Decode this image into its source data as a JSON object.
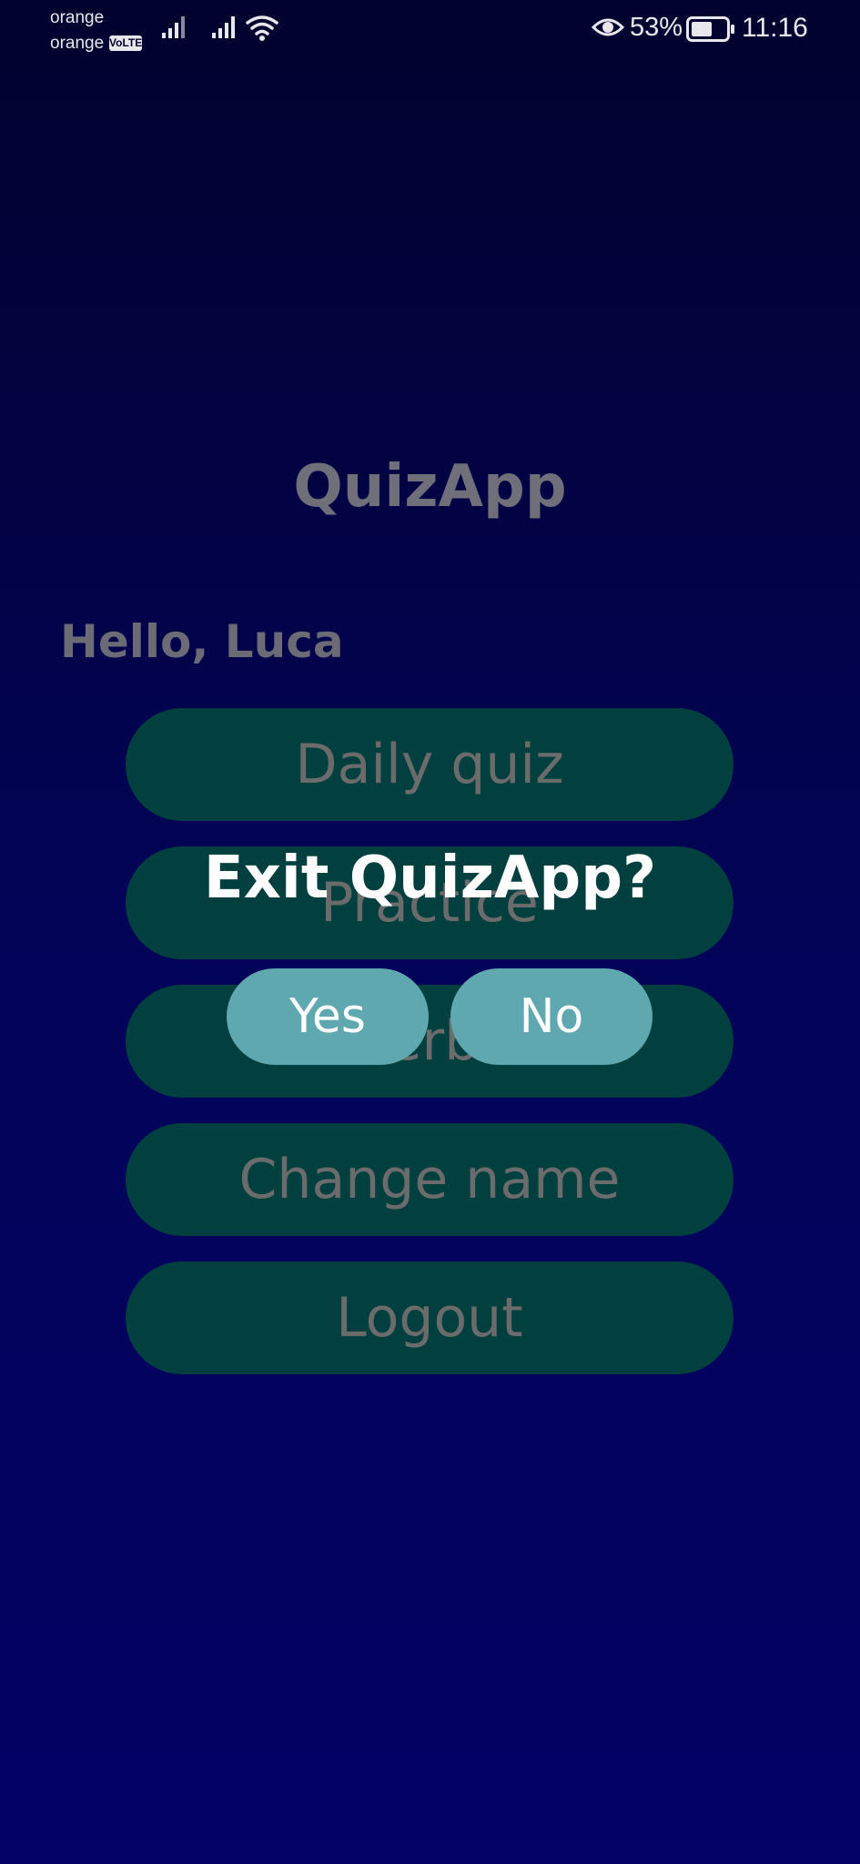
{
  "status_bar": {
    "carrier_1": "orange",
    "carrier_2": "orange",
    "volte_badge": "VoLTE",
    "battery_percent": "53%",
    "time": "11:16",
    "icons": [
      "signal-icon",
      "signal-icon",
      "wifi-icon",
      "eye-icon",
      "battery-icon"
    ]
  },
  "screen": {
    "app_title": "QuizApp",
    "greeting": "Hello, Luca",
    "menu": [
      {
        "label": "Daily quiz"
      },
      {
        "label": "Practice"
      },
      {
        "label": "Leaderboard"
      },
      {
        "label": "Change name"
      },
      {
        "label": "Logout"
      }
    ]
  },
  "dialog": {
    "title": "Exit QuizApp?",
    "yes_label": "Yes",
    "no_label": "No"
  },
  "colors": {
    "background_top": "#02022e",
    "background_bottom": "#030265",
    "menu_button": "#01403e",
    "dialog_button": "#5fa8b0"
  }
}
